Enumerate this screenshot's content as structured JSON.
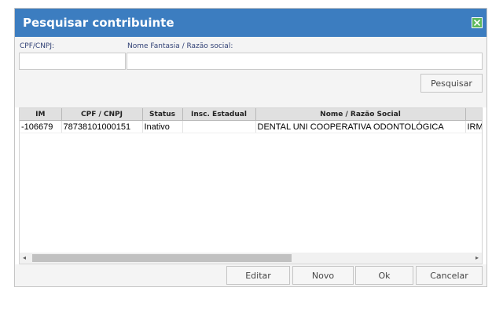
{
  "dialog": {
    "title": "Pesquisar contribuinte",
    "close_icon": "close-icon"
  },
  "filters": {
    "cpf_label": "CPF/CNPJ:",
    "cpf_value": "",
    "nome_label": "Nome Fantasia / Razão social:",
    "nome_value": "",
    "search_label": "Pesquisar"
  },
  "table": {
    "headers": [
      "IM",
      "CPF / CNPJ",
      "Status",
      "Insc. Estadual",
      "Nome / Razão Social",
      ""
    ],
    "rows": [
      [
        "-106679",
        "78738101000151",
        "Inativo",
        "",
        "DENTAL UNI COOPERATIVA ODONTOLÓGICA",
        "IRM"
      ]
    ]
  },
  "scrollbar": {
    "left_arrow": "◂",
    "right_arrow": "▸"
  },
  "actions": {
    "edit_label": "Editar",
    "new_label": "Novo",
    "ok_label": "Ok",
    "cancel_label": "Cancelar"
  },
  "colors": {
    "titlebar": "#3c7dc0",
    "close_button": "#5cb85c",
    "panel_background": "#f4f4f4"
  }
}
